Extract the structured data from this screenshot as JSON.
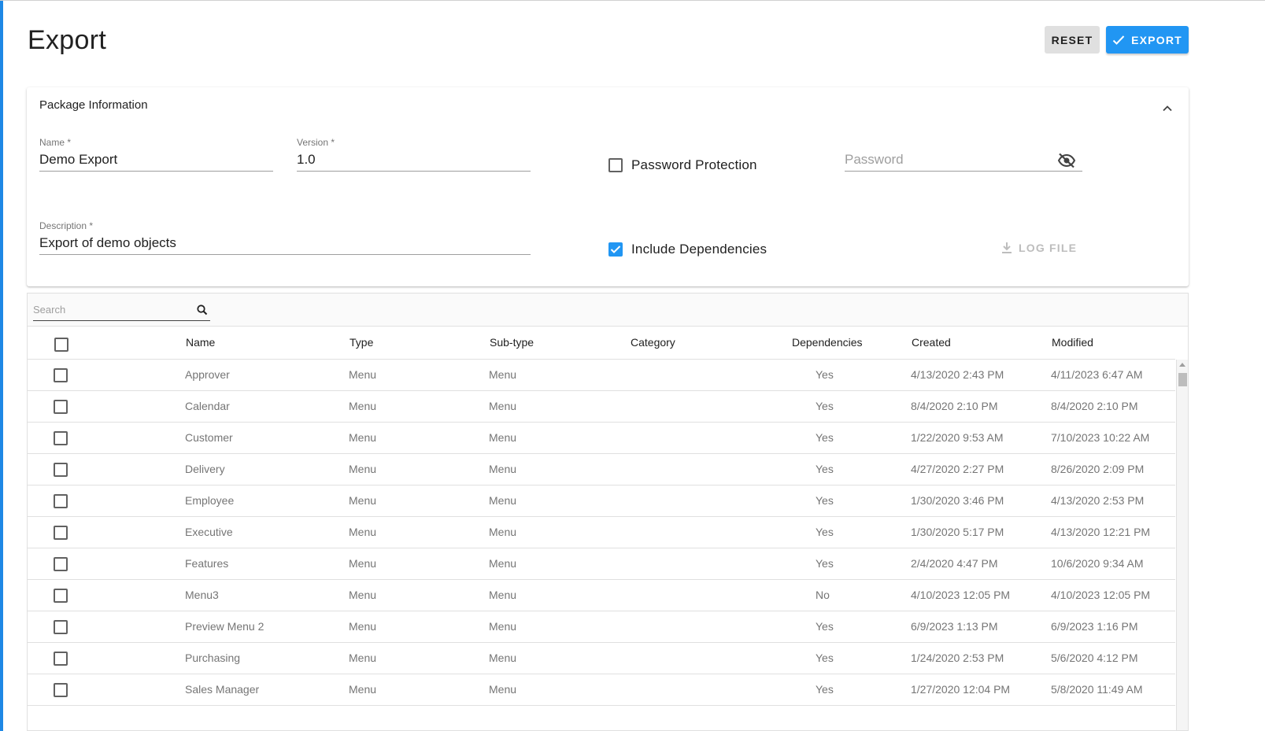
{
  "page": {
    "title": "Export"
  },
  "actions": {
    "reset_label": "RESET",
    "export_label": "EXPORT"
  },
  "package": {
    "title": "Package Information",
    "name_label": "Name *",
    "name_value": "Demo Export",
    "version_label": "Version *",
    "version_value": "1.0",
    "description_label": "Description *",
    "description_value": "Export of demo objects",
    "password_protection_label": "Password Protection",
    "password_protection_checked": false,
    "password_placeholder": "Password",
    "include_dependencies_label": "Include Dependencies",
    "include_dependencies_checked": true,
    "log_file_label": "LOG FILE"
  },
  "grid": {
    "search_placeholder": "Search",
    "columns": [
      "Name",
      "Type",
      "Sub-type",
      "Category",
      "Dependencies",
      "Created",
      "Modified"
    ],
    "rows": [
      {
        "name": "Approver",
        "type": "Menu",
        "subtype": "Menu",
        "category": "",
        "dependencies": "Yes",
        "created": "4/13/2020 2:43 PM",
        "modified": "4/11/2023 6:47 AM"
      },
      {
        "name": "Calendar",
        "type": "Menu",
        "subtype": "Menu",
        "category": "",
        "dependencies": "Yes",
        "created": "8/4/2020 2:10 PM",
        "modified": "8/4/2020 2:10 PM"
      },
      {
        "name": "Customer",
        "type": "Menu",
        "subtype": "Menu",
        "category": "",
        "dependencies": "Yes",
        "created": "1/22/2020 9:53 AM",
        "modified": "7/10/2023 10:22 AM"
      },
      {
        "name": "Delivery",
        "type": "Menu",
        "subtype": "Menu",
        "category": "",
        "dependencies": "Yes",
        "created": "4/27/2020 2:27 PM",
        "modified": "8/26/2020 2:09 PM"
      },
      {
        "name": "Employee",
        "type": "Menu",
        "subtype": "Menu",
        "category": "",
        "dependencies": "Yes",
        "created": "1/30/2020 3:46 PM",
        "modified": "4/13/2020 2:53 PM"
      },
      {
        "name": "Executive",
        "type": "Menu",
        "subtype": "Menu",
        "category": "",
        "dependencies": "Yes",
        "created": "1/30/2020 5:17 PM",
        "modified": "4/13/2020 12:21 PM"
      },
      {
        "name": "Features",
        "type": "Menu",
        "subtype": "Menu",
        "category": "",
        "dependencies": "Yes",
        "created": "2/4/2020 4:47 PM",
        "modified": "10/6/2020 9:34 AM"
      },
      {
        "name": "Menu3",
        "type": "Menu",
        "subtype": "Menu",
        "category": "",
        "dependencies": "No",
        "created": "4/10/2023 12:05 PM",
        "modified": "4/10/2023 12:05 PM"
      },
      {
        "name": "Preview Menu 2",
        "type": "Menu",
        "subtype": "Menu",
        "category": "",
        "dependencies": "Yes",
        "created": "6/9/2023 1:13 PM",
        "modified": "6/9/2023 1:16 PM"
      },
      {
        "name": "Purchasing",
        "type": "Menu",
        "subtype": "Menu",
        "category": "",
        "dependencies": "Yes",
        "created": "1/24/2020 2:53 PM",
        "modified": "5/6/2020 4:12 PM"
      },
      {
        "name": "Sales Manager",
        "type": "Menu",
        "subtype": "Menu",
        "category": "",
        "dependencies": "Yes",
        "created": "1/27/2020 12:04 PM",
        "modified": "5/8/2020 11:49 AM"
      }
    ]
  },
  "colors": {
    "accent": "#2196f3",
    "secondary_button": "#e0e0e0"
  },
  "icons": {
    "export_button": "check-icon",
    "collapse": "chevron-up-icon",
    "password_visibility": "eye-off-icon",
    "log_file": "download-icon",
    "search": "search-icon"
  }
}
